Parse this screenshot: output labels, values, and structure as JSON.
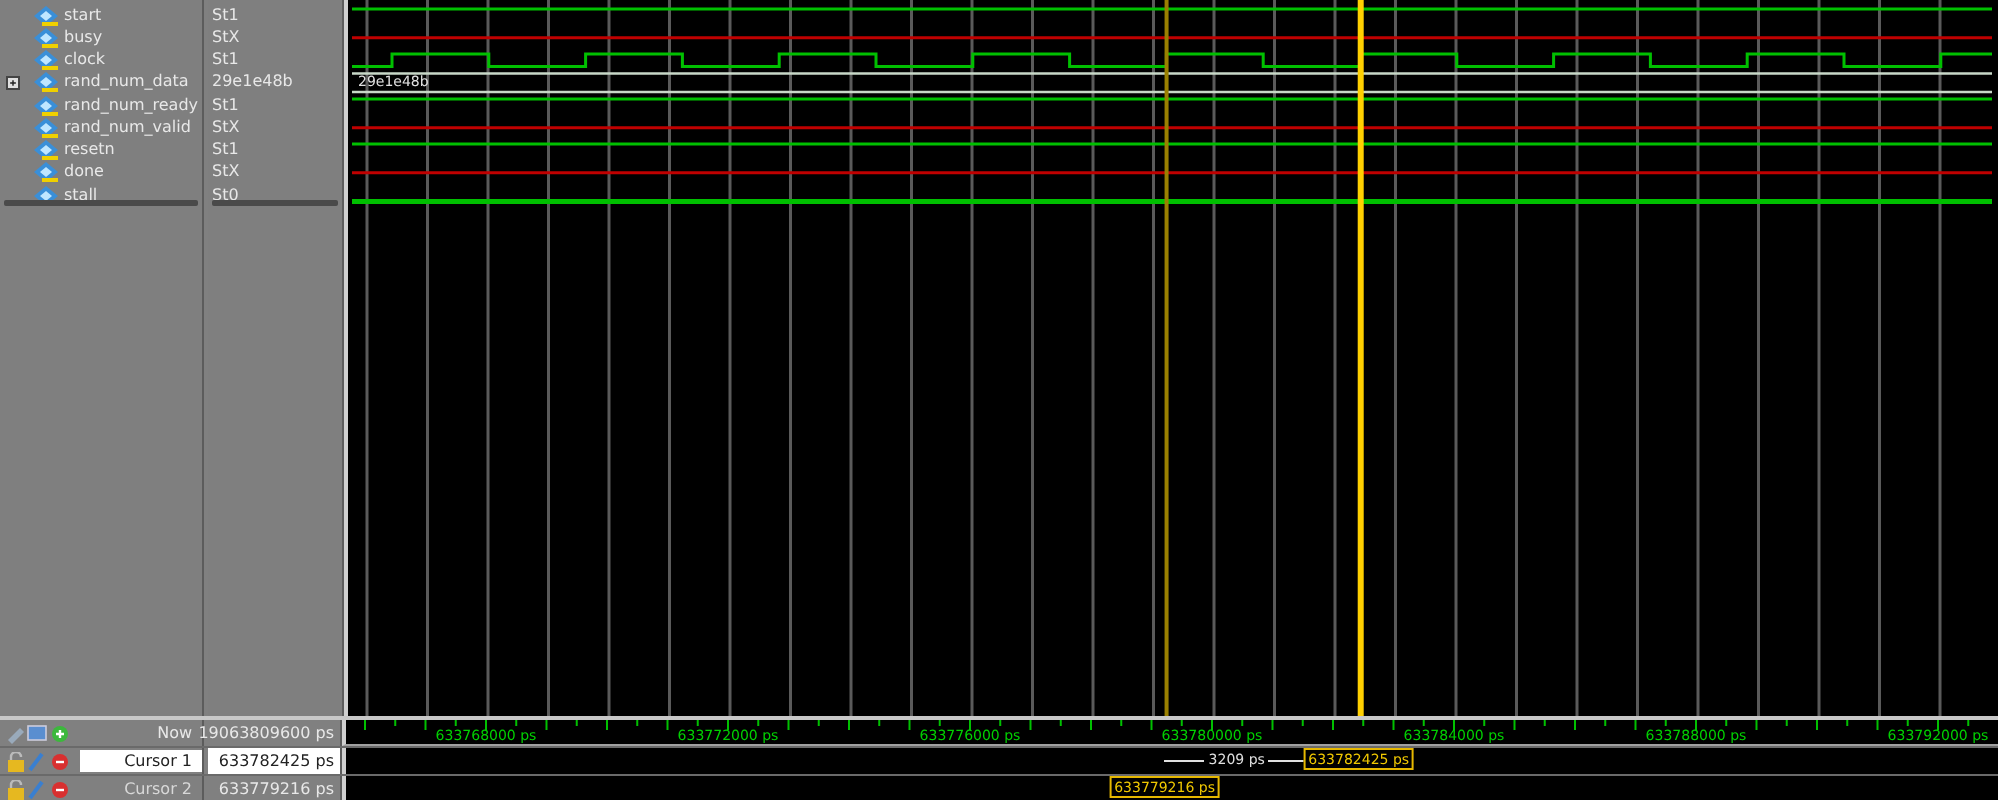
{
  "signals": [
    {
      "name": "start",
      "value": "St1",
      "kind": "high",
      "expandable": false
    },
    {
      "name": "busy",
      "value": "StX",
      "kind": "unknown",
      "expandable": false
    },
    {
      "name": "clock",
      "value": "St1",
      "kind": "clock",
      "expandable": false
    },
    {
      "name": "rand_num_data",
      "value": "29e1e48b",
      "kind": "bus",
      "expandable": true,
      "wave_text": "29e1e48b"
    },
    {
      "name": "rand_num_ready",
      "value": "St1",
      "kind": "high",
      "expandable": false
    },
    {
      "name": "rand_num_valid",
      "value": "StX",
      "kind": "unknown",
      "expandable": false
    },
    {
      "name": "resetn",
      "value": "St1",
      "kind": "high",
      "expandable": false
    },
    {
      "name": "done",
      "value": "StX",
      "kind": "unknown",
      "expandable": false
    },
    {
      "name": "stall",
      "value": "St0",
      "kind": "low",
      "expandable": false
    }
  ],
  "now": {
    "label": "Now",
    "value": "19063809600 ps"
  },
  "time_labels": [
    "633768000 ps",
    "633772000 ps",
    "633776000 ps",
    "633780000 ps",
    "633784000 ps",
    "633788000 ps",
    "633792000 ps"
  ],
  "cursors": [
    {
      "label": "Cursor 1",
      "value": "633782425 ps",
      "selected": true,
      "marker": "633782425 ps"
    },
    {
      "label": "Cursor 2",
      "value": "633779216 ps",
      "selected": false,
      "marker": "633779216 ps"
    }
  ],
  "cursor_delta": "3209 ps"
}
